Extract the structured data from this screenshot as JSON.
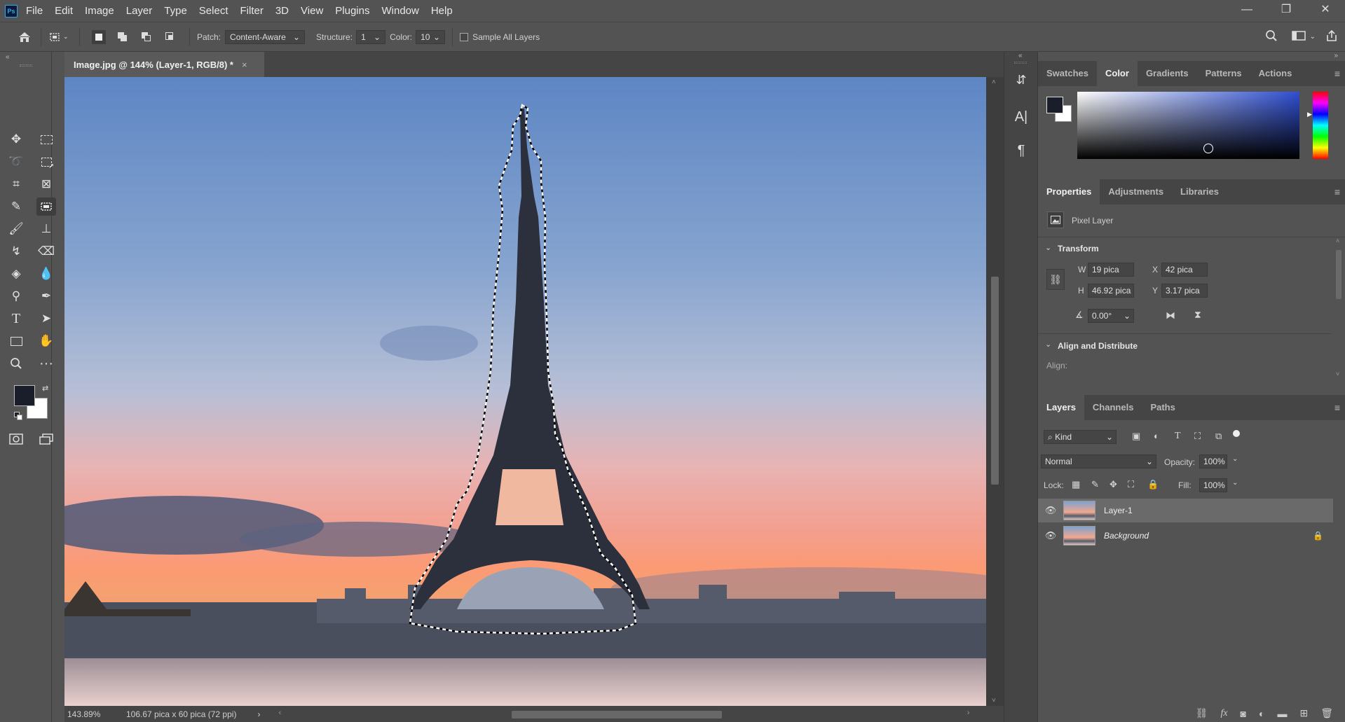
{
  "app": {
    "logo": "Ps",
    "window_controls": [
      "—",
      "❐",
      "✕"
    ]
  },
  "menu": [
    "File",
    "Edit",
    "Image",
    "Layer",
    "Type",
    "Select",
    "Filter",
    "3D",
    "View",
    "Plugins",
    "Window",
    "Help"
  ],
  "options": {
    "patch_label": "Patch:",
    "patch_value": "Content-Aware",
    "structure_label": "Structure:",
    "structure_value": "1",
    "color_label": "Color:",
    "color_value": "10",
    "sample_all_layers": "Sample All Layers"
  },
  "document": {
    "tab_title": "Image.jpg @ 144% (Layer-1, RGB/8) *",
    "zoom": "143.89%",
    "doc_info": "106.67 pica x 60 pica (72 ppi)"
  },
  "panels": {
    "color_tabs": [
      "Swatches",
      "Color",
      "Gradients",
      "Patterns",
      "Actions"
    ],
    "colors": {
      "foreground": "#1a1e2b",
      "background": "#ffffff",
      "accent": "#2f4fd1"
    },
    "properties_tabs": [
      "Properties",
      "Adjustments",
      "Libraries"
    ],
    "pixel_layer": "Pixel Layer",
    "transform_label": "Transform",
    "w_label": "W",
    "w_value": "19 pica",
    "x_label": "X",
    "x_value": "42 pica",
    "h_label": "H",
    "h_value": "46.92 pica",
    "y_label": "Y",
    "y_value": "3.17 pica",
    "angle_value": "0.00°",
    "align_label": "Align and Distribute",
    "align_sub": "Align:",
    "layers_tabs": [
      "Layers",
      "Channels",
      "Paths"
    ],
    "kind": "Kind",
    "blend_mode": "Normal",
    "opacity_label": "Opacity:",
    "opacity_value": "100%",
    "lock_label": "Lock:",
    "fill_label": "Fill:",
    "fill_value": "100%",
    "layers": [
      {
        "name": "Layer-1"
      },
      {
        "name": "Background"
      }
    ]
  }
}
